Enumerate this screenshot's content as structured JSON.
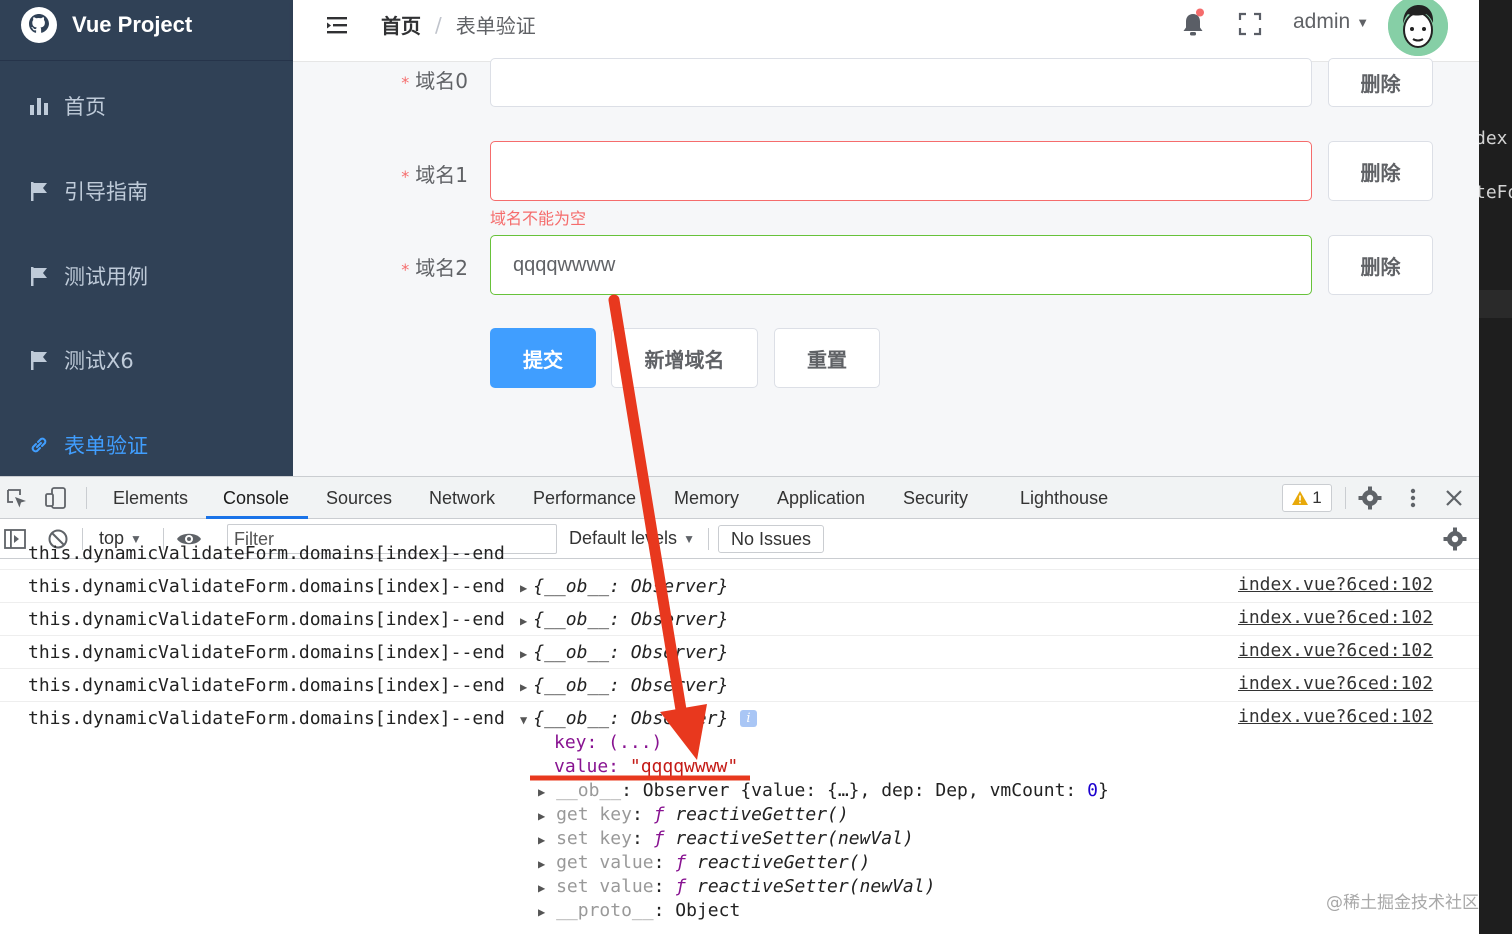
{
  "app": {
    "title": "Vue Project",
    "sidebar": {
      "items": [
        {
          "label": "首页",
          "icon": "bar-chart-icon"
        },
        {
          "label": "引导指南",
          "icon": "flag-icon"
        },
        {
          "label": "测试用例",
          "icon": "flag-icon"
        },
        {
          "label": "测试X6",
          "icon": "flag-icon"
        },
        {
          "label": "表单验证",
          "icon": "link-icon",
          "active": true
        }
      ]
    },
    "breadcrumb": {
      "home": "首页",
      "sep": "/",
      "current": "表单验证"
    },
    "user": {
      "name": "admin"
    }
  },
  "form": {
    "fields": [
      {
        "label": "域名0",
        "value": "",
        "delete_label": "删除",
        "state": "normal"
      },
      {
        "label": "域名1",
        "value": "",
        "delete_label": "删除",
        "state": "error",
        "error": "域名不能为空"
      },
      {
        "label": "域名2",
        "value": "qqqqwwww",
        "delete_label": "删除",
        "state": "success"
      }
    ],
    "required_mark": "*",
    "buttons": {
      "submit": "提交",
      "add": "新增域名",
      "reset": "重置"
    }
  },
  "devtools": {
    "tabs": [
      "Elements",
      "Console",
      "Sources",
      "Network",
      "Performance",
      "Memory",
      "Application",
      "Security",
      "Lighthouse"
    ],
    "active_tab": "Console",
    "warning_count": "1",
    "toolbar": {
      "context": "top",
      "filter_placeholder": "Filter",
      "levels": "Default levels",
      "issues": "No Issues"
    },
    "logs": [
      {
        "msg": "this.dynamicValidateForm.domains[index]--end",
        "obj": "{__ob__: Observer}",
        "src": "index.vue?6ced:102"
      },
      {
        "msg": "this.dynamicValidateForm.domains[index]--end",
        "obj": "{__ob__: Observer}",
        "src": "index.vue?6ced:102"
      },
      {
        "msg": "this.dynamicValidateForm.domains[index]--end",
        "obj": "{__ob__: Observer}",
        "src": "index.vue?6ced:102"
      },
      {
        "msg": "this.dynamicValidateForm.domains[index]--end",
        "obj": "{__ob__: Observer}",
        "src": "index.vue?6ced:102"
      },
      {
        "msg": "this.dynamicValidateForm.domains[index]--end",
        "obj": "{__ob__: Observer}",
        "src": "index.vue?6ced:102",
        "expanded": true
      }
    ],
    "expanded": {
      "key_line": "key: (...)",
      "value_key": "value: ",
      "value_str": "\"qqqqwwww\"",
      "ob_key": "__ob__",
      "ob_rest": ": Observer {value: {…}, dep: Dep, vmCount: ",
      "ob_count": "0",
      "ob_end": "}",
      "getters": [
        {
          "key": "get key",
          "fn": "reactiveGetter()"
        },
        {
          "key": "set key",
          "fn": "reactiveSetter(newVal)"
        },
        {
          "key": "get value",
          "fn": "reactiveGetter()"
        },
        {
          "key": "set value",
          "fn": "reactiveSetter(newVal)"
        }
      ],
      "proto_key": "__proto__",
      "proto_val": ": Object"
    }
  },
  "side_code": {
    "line1": "dex",
    "line2": "teFo"
  },
  "watermark": "@稀土掘金技术社区",
  "colors": {
    "annotation": "#e8381e",
    "sidebar": "#304156",
    "primary": "#409eff",
    "error": "#f56c6c",
    "success": "#67c23a"
  }
}
